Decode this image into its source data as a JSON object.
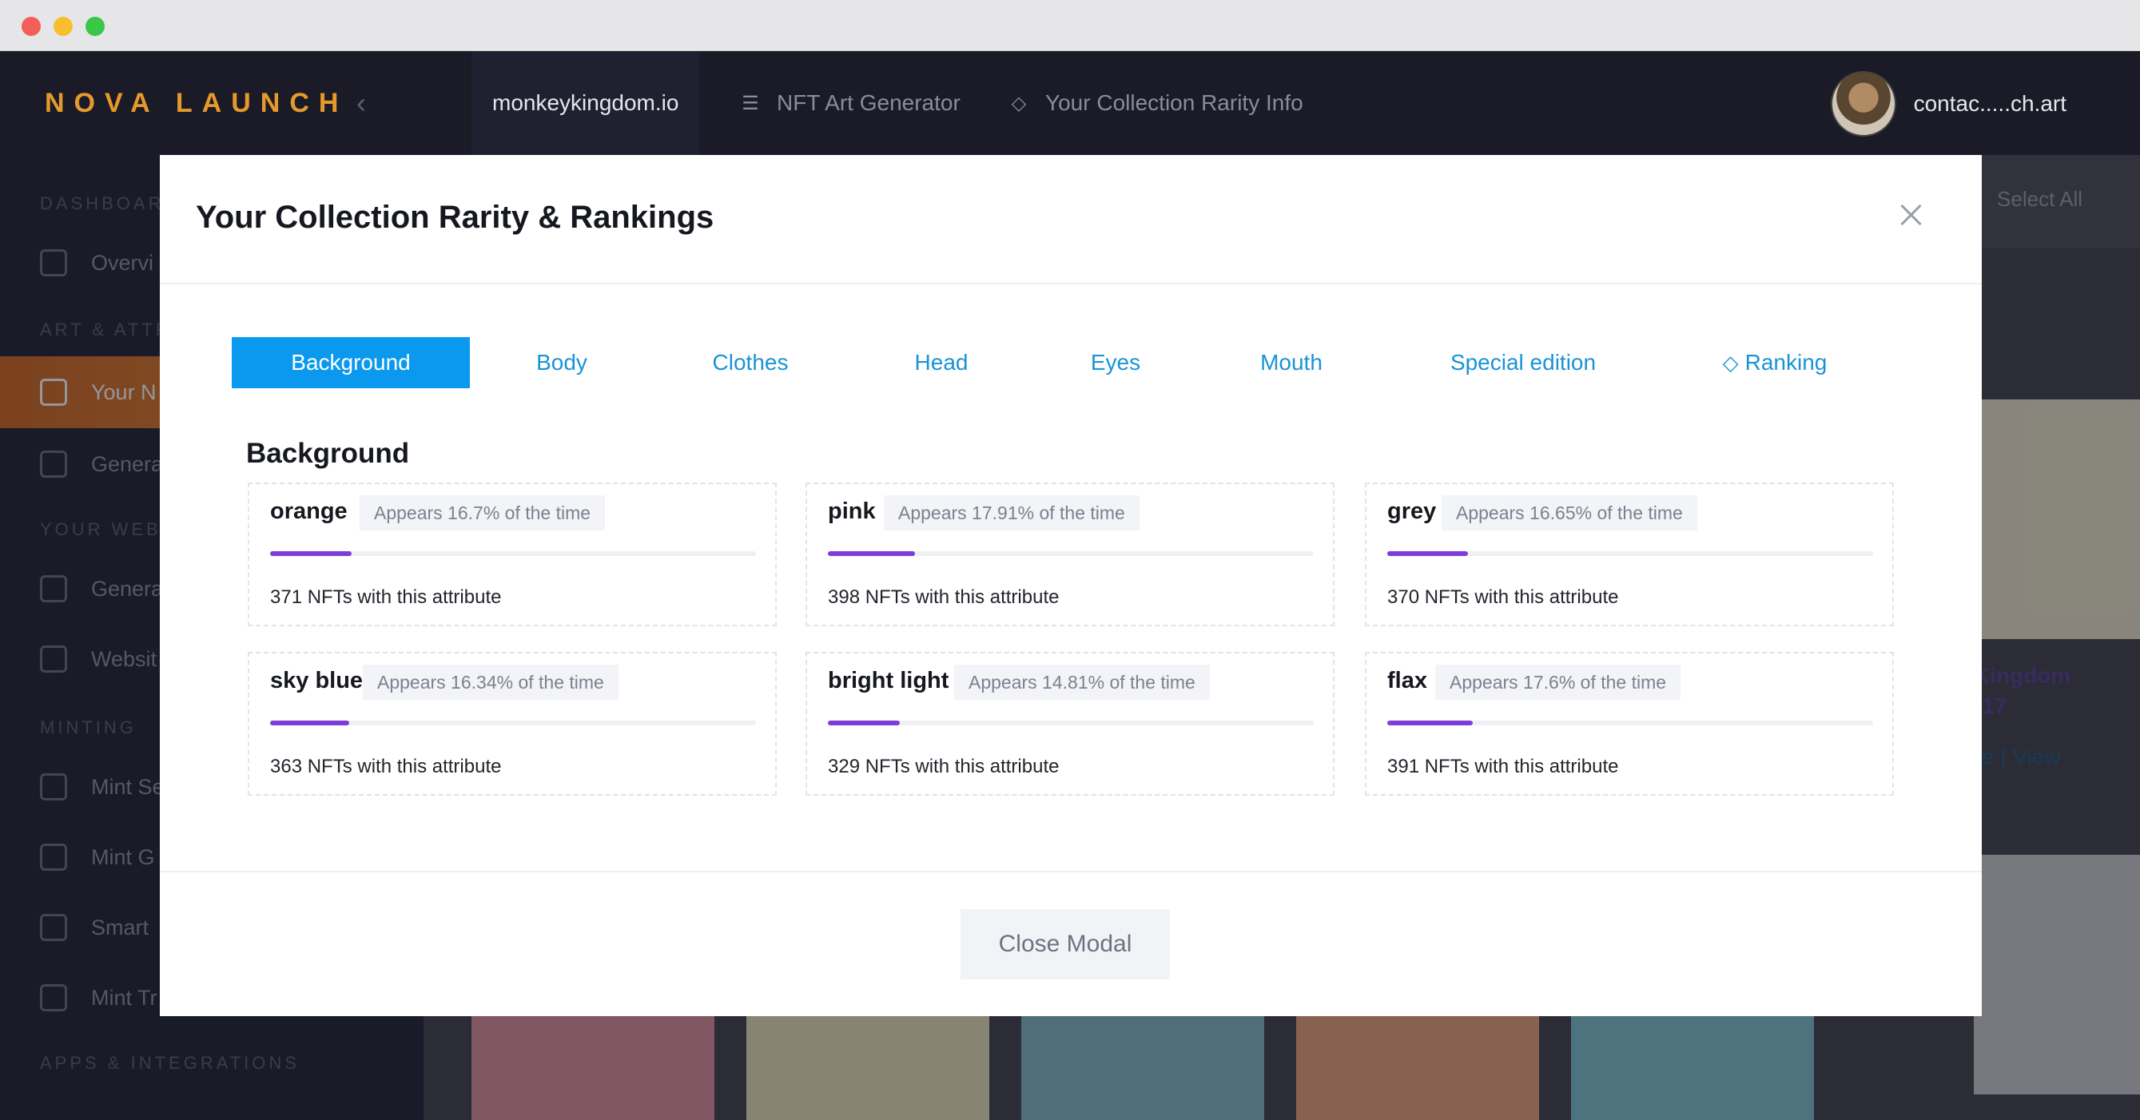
{
  "topnav": {
    "logo": "NOVA LAUNCH",
    "collapse_icon": "chevron-left-icon",
    "items": [
      {
        "label": "monkeykingdom.io"
      },
      {
        "label": "NFT Art Generator",
        "icon": "layers-icon"
      },
      {
        "label": "Your Collection Rarity Info",
        "icon": "diamond-icon"
      }
    ],
    "user_email": "contac.....ch.art"
  },
  "sidebar": {
    "sections": [
      "DASHBOARD",
      "ART & ATTRI",
      "YOUR WEBSI",
      "MINTING",
      "APPS & INTEGRATIONS"
    ],
    "items": [
      {
        "label": "Overvi"
      },
      {
        "label": "Your N"
      },
      {
        "label": "Genera"
      },
      {
        "label": "Genera"
      },
      {
        "label": "Websit"
      },
      {
        "label": "Mint Se"
      },
      {
        "label": "Mint G"
      },
      {
        "label": "Smart"
      },
      {
        "label": "Mint Tr"
      }
    ]
  },
  "background_page": {
    "select_all": "Select All",
    "card_title_1": "Kingdom",
    "card_title_2": "17",
    "card_link": "e | View"
  },
  "modal": {
    "title": "Your Collection Rarity & Rankings",
    "tabs": [
      {
        "label": "Background"
      },
      {
        "label": "Body"
      },
      {
        "label": "Clothes"
      },
      {
        "label": "Head"
      },
      {
        "label": "Eyes"
      },
      {
        "label": "Mouth"
      },
      {
        "label": "Special edition"
      },
      {
        "label": "Ranking"
      }
    ],
    "section_title": "Background",
    "attributes": [
      {
        "name": "orange",
        "badge": "Appears 16.7% of the time",
        "pct": 16.7,
        "count": "371 NFTs with this attribute"
      },
      {
        "name": "pink",
        "badge": "Appears 17.91% of the time",
        "pct": 17.91,
        "count": "398 NFTs with this attribute"
      },
      {
        "name": "grey",
        "badge": "Appears 16.65% of the time",
        "pct": 16.65,
        "count": "370 NFTs with this attribute"
      },
      {
        "name": "sky blue",
        "badge": "Appears 16.34% of the time",
        "pct": 16.34,
        "count": "363 NFTs with this attribute"
      },
      {
        "name": "bright light",
        "badge": "Appears 14.81% of the time",
        "pct": 14.81,
        "count": "329 NFTs with this attribute"
      },
      {
        "name": "flax",
        "badge": "Appears 17.6% of the time",
        "pct": 17.6,
        "count": "391 NFTs with this attribute"
      }
    ],
    "close_button": "Close Modal"
  },
  "colors": {
    "accent_blue": "#0a99ee",
    "progress_purple": "#7d3ed8",
    "sidebar_active_orange": "#e07a28"
  }
}
